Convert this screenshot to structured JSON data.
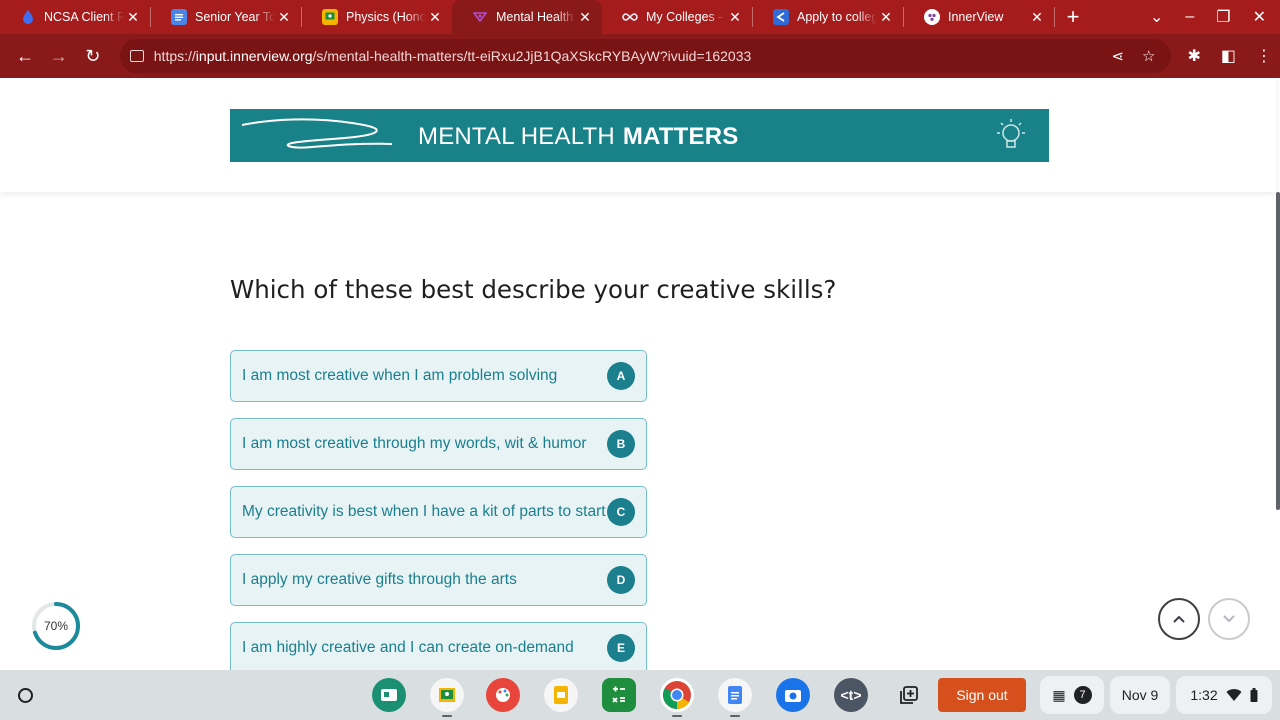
{
  "browser": {
    "tabs": [
      {
        "title": "NCSA Client Re",
        "icon": "ncsa-drop-icon",
        "color": "#4a6cf7"
      },
      {
        "title": "Senior Year To",
        "icon": "docs-icon",
        "color": "#4a86e8"
      },
      {
        "title": "Physics (Hono",
        "icon": "classroom-icon",
        "color": "#f4b400"
      },
      {
        "title": "Mental Health",
        "icon": "innerview-icon",
        "color": "#9c27b0"
      },
      {
        "title": "My Colleges - S",
        "icon": "infinity-icon",
        "color": "#2f6ad6"
      },
      {
        "title": "Apply to colleg",
        "icon": "commonapp-icon",
        "color": "#2f6ad6"
      },
      {
        "title": "InnerView",
        "icon": "innerview-icon",
        "color": "#ffffff"
      }
    ],
    "active_tab": 3,
    "url_prefix": "https://",
    "url_host": "input.innerview.org",
    "url_path": "/s/mental-health-matters/tt-eiRxu2JjB1QaXSkcRYBAyW?ivuid=162033"
  },
  "page": {
    "banner": {
      "text_light": "MENTAL HEALTH",
      "text_bold": "MATTERS"
    },
    "question": "Which of these best describe your creative skills?",
    "choices": [
      {
        "label": "I am most creative when I am problem solving",
        "key": "A"
      },
      {
        "label": "I am most creative through my words, wit & humor",
        "key": "B"
      },
      {
        "label": "My creativity is best when I have a kit of parts to start",
        "key": "C"
      },
      {
        "label": "I apply my creative gifts through the arts",
        "key": "D"
      },
      {
        "label": "I am highly creative and I can create on-demand",
        "key": "E"
      }
    ],
    "progress": {
      "label": "70%",
      "value": 0.7,
      "color": "#1b8a9a"
    }
  },
  "shelf": {
    "signout_label": "Sign out",
    "notification_count": "7",
    "date": "Nov 9",
    "time": "1:32"
  }
}
